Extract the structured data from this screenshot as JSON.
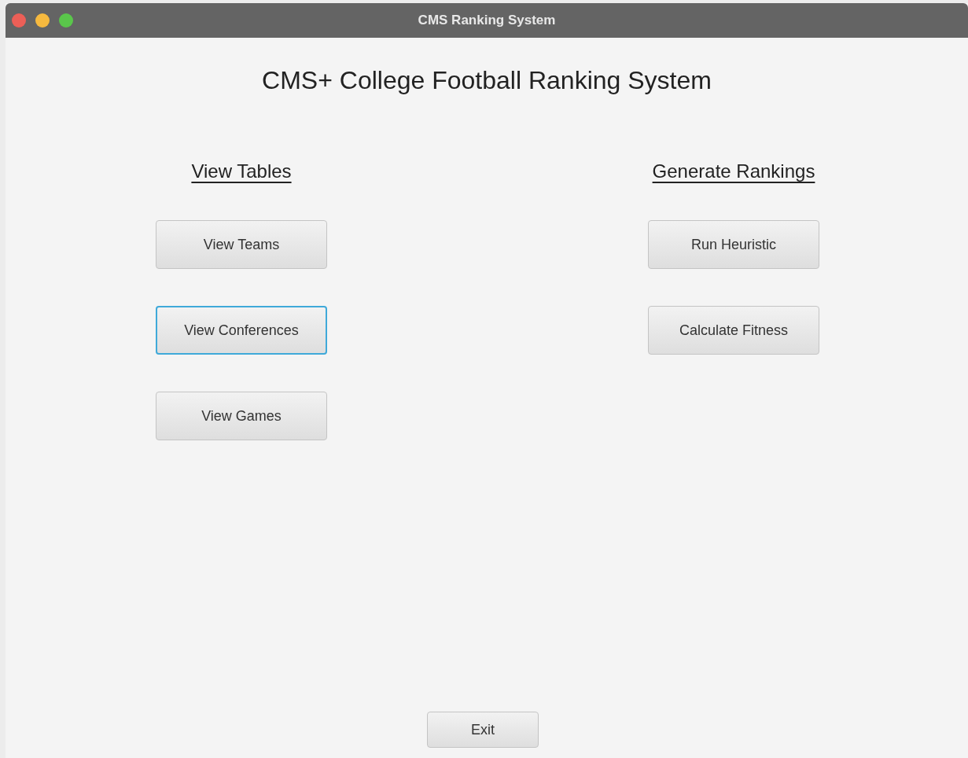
{
  "window": {
    "title": "CMS Ranking System"
  },
  "heading": "CMS+ College Football Ranking System",
  "sections": [
    {
      "title": "View Tables",
      "buttons": [
        {
          "label": "View Teams",
          "focused": false
        },
        {
          "label": "View Conferences",
          "focused": true
        },
        {
          "label": "View Games",
          "focused": false
        }
      ]
    },
    {
      "title": "Generate Rankings",
      "buttons": [
        {
          "label": "Run Heuristic",
          "focused": false
        },
        {
          "label": "Calculate Fitness",
          "focused": false
        }
      ]
    }
  ],
  "exit_button": {
    "label": "Exit",
    "focused": false
  }
}
